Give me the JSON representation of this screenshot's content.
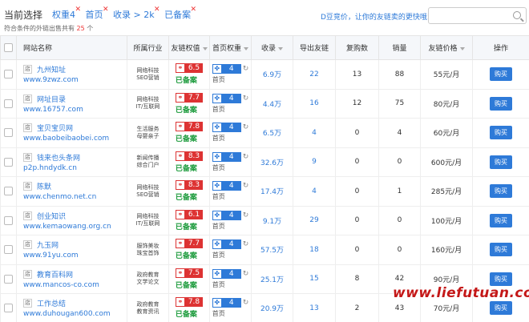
{
  "header": {
    "title": "当前选择",
    "filters": [
      {
        "label": "权重4"
      },
      {
        "label": "首页"
      },
      {
        "label": "收录 > 2k"
      },
      {
        "label": "已备案"
      }
    ],
    "promo": "D豆竞价，让你的友链卖的更快哦！",
    "search_placeholder": "",
    "count_prefix": "符合条件的外链出售共有",
    "count": "25",
    "count_suffix": "个"
  },
  "table": {
    "columns": [
      "网站名称",
      "所属行业",
      "友链权值",
      "首页权重",
      "收录",
      "导出友链",
      "复购数",
      "销量",
      "友链价格",
      "操作"
    ],
    "rows": [
      {
        "tag": "店",
        "title": "九州知址",
        "domain": "www.9zwz.com",
        "ind1": "网络科技",
        "ind2": "SEO营销",
        "weight": "6.5",
        "beian": "已备案",
        "home": "4",
        "home_label": "首页",
        "index": "6.9万",
        "export": "22",
        "rebuy": "13",
        "sales": "88",
        "price": "55元/月",
        "buy": "购买"
      },
      {
        "tag": "店",
        "title": "网址目录",
        "domain": "www.16757.com",
        "ind1": "网络科技",
        "ind2": "IT/互联网",
        "weight": "7.7",
        "beian": "已备案",
        "home": "4",
        "home_label": "首页",
        "index": "4.4万",
        "export": "16",
        "rebuy": "12",
        "sales": "75",
        "price": "80元/月",
        "buy": "购买"
      },
      {
        "tag": "店",
        "title": "宝贝宝贝网",
        "domain": "www.baobeibaobei.com",
        "ind1": "生活服务",
        "ind2": "母婴亲子",
        "weight": "7.8",
        "beian": "已备案",
        "home": "4",
        "home_label": "首页",
        "index": "6.5万",
        "export": "4",
        "rebuy": "0",
        "sales": "4",
        "price": "60元/月",
        "buy": "购买"
      },
      {
        "tag": "店",
        "title": "钱来也头条网",
        "domain": "p2p.hndydk.cn",
        "ind1": "新闻传播",
        "ind2": "综合门户",
        "weight": "8.3",
        "beian": "已备案",
        "home": "4",
        "home_label": "首页",
        "index": "32.6万",
        "export": "9",
        "rebuy": "0",
        "sales": "0",
        "price": "600元/月",
        "buy": "购买"
      },
      {
        "tag": "店",
        "title": "陈默",
        "domain": "www.chenmo.net.cn",
        "ind1": "网络科技",
        "ind2": "SEO营销",
        "weight": "8.3",
        "beian": "已备案",
        "home": "4",
        "home_label": "首页",
        "index": "17.4万",
        "export": "4",
        "rebuy": "0",
        "sales": "1",
        "price": "285元/月",
        "buy": "购买"
      },
      {
        "tag": "店",
        "title": "创业知识",
        "domain": "www.kemaowang.org.cn",
        "ind1": "网络科技",
        "ind2": "IT/互联网",
        "weight": "6.1",
        "beian": "已备案",
        "home": "4",
        "home_label": "首页",
        "index": "9.1万",
        "export": "29",
        "rebuy": "0",
        "sales": "0",
        "price": "100元/月",
        "buy": "购买"
      },
      {
        "tag": "店",
        "title": "九玉网",
        "domain": "www.91yu.com",
        "ind1": "服饰美妆",
        "ind2": "珠宝首饰",
        "weight": "7.7",
        "beian": "已备案",
        "home": "4",
        "home_label": "首页",
        "index": "57.5万",
        "export": "18",
        "rebuy": "0",
        "sales": "0",
        "price": "160元/月",
        "buy": "购买"
      },
      {
        "tag": "店",
        "title": "教育百科网",
        "domain": "www.mancos-co.com",
        "ind1": "政府教育",
        "ind2": "文学论文",
        "weight": "7.5",
        "beian": "已备案",
        "home": "4",
        "home_label": "首页",
        "index": "25.1万",
        "export": "15",
        "rebuy": "8",
        "sales": "42",
        "price": "90元/月",
        "buy": "购买"
      },
      {
        "tag": "店",
        "title": "工作总结",
        "domain": "www.duhougan600.com",
        "ind1": "政府教育",
        "ind2": "教育资讯",
        "weight": "7.8",
        "beian": "已备案",
        "home": "4",
        "home_label": "首页",
        "index": "20.9万",
        "export": "13",
        "rebuy": "2",
        "sales": "43",
        "price": "70元/月",
        "buy": "购买"
      }
    ]
  },
  "watermark": "www.liefutuan.com",
  "colors": {
    "link": "#2e7ad8",
    "weight_badge": "#dd3333",
    "beian": "#1a9a3a",
    "buy_button": "#2e7ad8"
  },
  "icons": {
    "weight_icon": "link-icon",
    "home_icon": "paw-icon",
    "refresh_icon": "refresh-icon"
  }
}
